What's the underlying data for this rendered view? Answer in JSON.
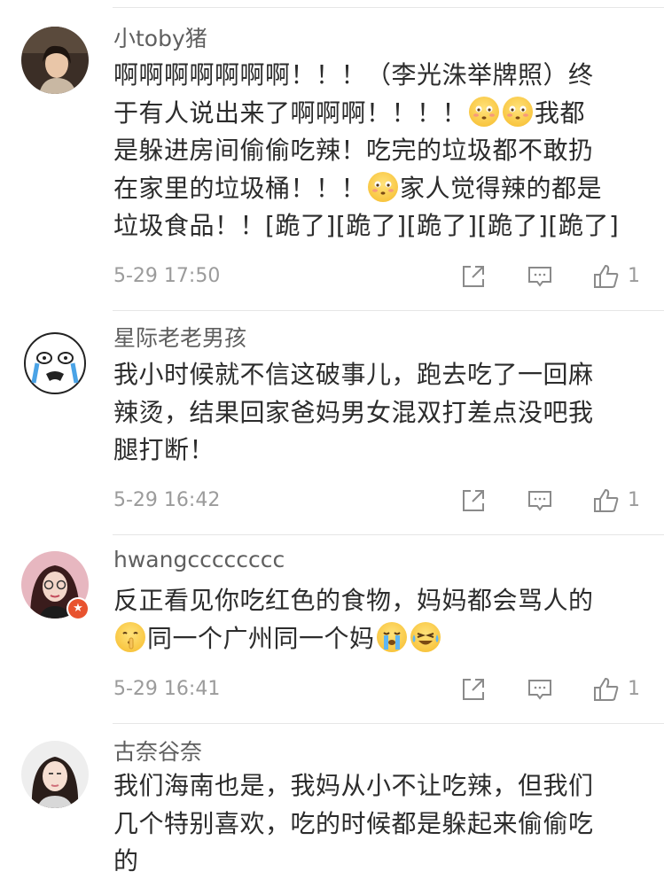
{
  "comments": [
    {
      "username": "小toby猪",
      "lines": [
        "啊啊啊啊啊啊啊！！！（李光洙举牌照）终",
        "于有人说出来了啊啊啊！！！！",
        "我都",
        "是躲进房间偷偷吃辣！吃完的垃圾都不敢扔",
        "在家里的垃圾桶！！！",
        "家人觉得辣的都是",
        "垃圾食品！！[跪了][跪了][跪了][跪了][跪了]"
      ],
      "time": "5-29 17:50",
      "likes": "1"
    },
    {
      "username": "星际老老男孩",
      "lines": [
        "我小时候就不信这破事儿，跑去吃了一回麻",
        "辣烫，结果回家爸妈男女混双打差点没吧我",
        "腿打断！"
      ],
      "time": "5-29 16:42",
      "likes": "1"
    },
    {
      "username": "hwangcccccccc",
      "lines": [
        "反正看见你吃红色的食物，妈妈都会骂人的",
        "同一个广州同一个妈"
      ],
      "time": "5-29 16:41",
      "likes": "1",
      "badge": "★"
    },
    {
      "username": "古奈谷奈",
      "lines": [
        "我们海南也是，我妈从小不让吃辣，但我们",
        "几个特别喜欢，吃的时候都是躲起来偷偷吃",
        "的"
      ]
    }
  ],
  "icons": {
    "share": "share-icon",
    "comment": "comment-icon",
    "like": "thumbs-up-icon",
    "emoji_flushed": "flushed-face-emoji",
    "emoji_shush": "shushing-face-emoji",
    "emoji_crying": "loudly-crying-emoji",
    "emoji_laugh": "tears-of-joy-emoji"
  },
  "colors": {
    "text": "#2c2c2c",
    "username": "#5f5f5f",
    "meta": "#9b9b9b",
    "divider": "#e6e6e6",
    "badge": "#e8532f"
  }
}
